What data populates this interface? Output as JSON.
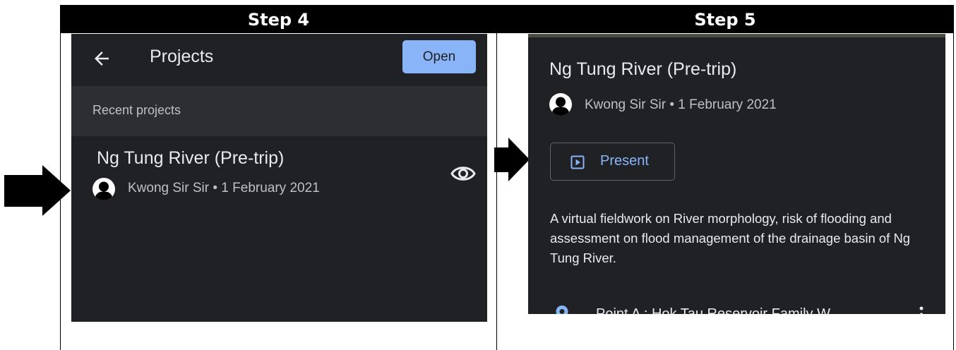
{
  "steps": [
    {
      "label": "Step 4"
    },
    {
      "label": "Step 5"
    }
  ],
  "step4": {
    "topbar_title": "Projects",
    "open_label": "Open",
    "section_label": "Recent projects",
    "project": {
      "title": "Ng Tung River (Pre-trip)",
      "meta": "Kwong Sir Sir • 1 February 2021"
    }
  },
  "step5": {
    "title": "Ng Tung River (Pre-trip)",
    "meta": "Kwong Sir Sir • 1 February 2021",
    "present_label": "Present",
    "description": "A virtual fieldwork on River morphology, risk of flooding and assessment on flood management of the drainage basin of Ng Tung River.",
    "next_item_label": "Point A : Hok Tau Reservoir Family W..."
  },
  "icons": {
    "back": "arrow-left-icon",
    "visibility": "eye-icon",
    "present": "play-box-icon",
    "location": "place-pin-icon",
    "more": "more-vert-icon",
    "avatar": "person-icon",
    "pointer": "pointer-arrow-icon"
  },
  "colors": {
    "screen_bg": "#202124",
    "section_bg": "#2d2e31",
    "accent": "#8ab4f8",
    "text_primary": "#e8eaed",
    "text_secondary": "#bdc1c6",
    "header_bar": "#000000"
  }
}
